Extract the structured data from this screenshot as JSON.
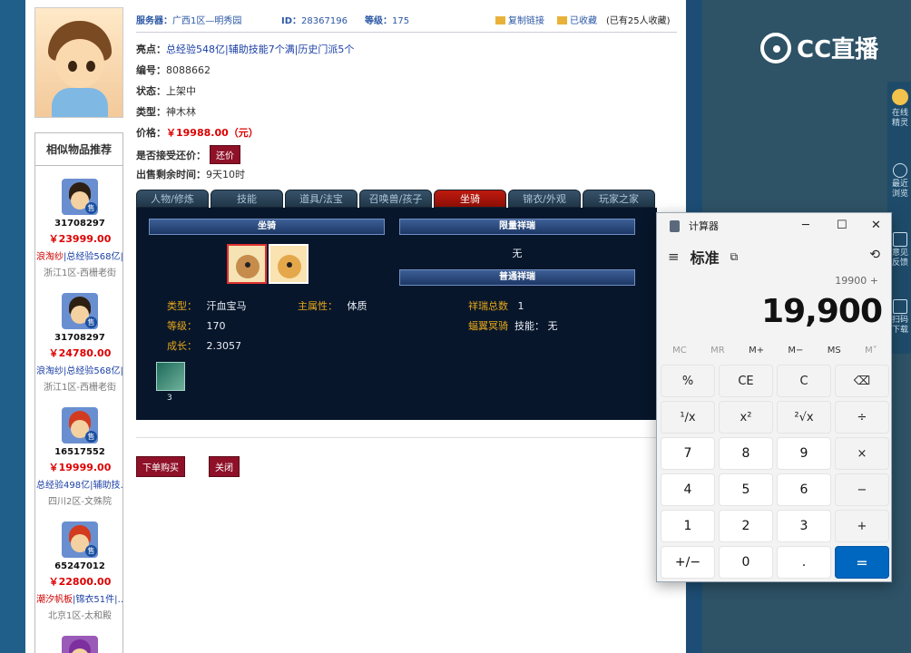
{
  "server": {
    "label": "服务器：",
    "value": "广西1区—明秀园"
  },
  "id": {
    "label": "ID：",
    "value": "28367196"
  },
  "level": {
    "label": "等级：",
    "value": "175"
  },
  "copy_link": "复制链接",
  "collected": "已收藏",
  "collect_count": "(已有25人收藏)",
  "highlights": {
    "label": "亮点：",
    "value": "总经验548亿|辅助技能7个满|历史门派5个"
  },
  "serial": {
    "label": "编号：",
    "value": "8088662"
  },
  "status": {
    "label": "状态：",
    "value": "上架中"
  },
  "type": {
    "label": "类型：",
    "value": "神木林"
  },
  "price": {
    "label": "价格：",
    "value": "￥19988.00（元）"
  },
  "accept_counter": {
    "label": "是否接受还价：",
    "button": "还价"
  },
  "remaining": {
    "label": "出售剩余时间：",
    "value": "9天10时"
  },
  "tabs": [
    "人物/修炼",
    "技能",
    "道具/法宝",
    "召唤兽/孩子",
    "坐骑",
    "锦衣/外观",
    "玩家之家"
  ],
  "panel": {
    "mount_title": "坐骑",
    "limited_title": "限量祥瑞",
    "limited_value": "无",
    "normal_title": "普通祥瑞",
    "attrs": [
      {
        "k": "类型：",
        "v": "汗血宝马"
      },
      {
        "k": "主属性：",
        "v": "体质"
      },
      {
        "k": "等级：",
        "v": "170"
      },
      {
        "k": "成长：",
        "v": "2.3057"
      }
    ],
    "right_attrs": [
      {
        "k": "祥瑞总数",
        "v": "1"
      },
      {
        "k": "蝠翼冥骑",
        "v": "技能：  无"
      }
    ],
    "skill_count": "3"
  },
  "buttons": {
    "buy": "下单购买",
    "close": "关闭"
  },
  "similar": {
    "title": "相似物品推荐",
    "items": [
      {
        "id": "31708297",
        "price": "￥23999.00",
        "desc_red": "浪淘纱",
        "desc": "|总经验568亿|…",
        "server": "浙江1区-西栅老街"
      },
      {
        "id": "31708297",
        "price": "￥24780.00",
        "desc_red": "",
        "desc": "浪淘纱|总经验568亿|…",
        "server": "浙江1区-西栅老街"
      },
      {
        "id": "16517552",
        "price": "￥19999.00",
        "desc_red": "",
        "desc": "总经验498亿|辅助技…",
        "server": "四川2区-文殊院"
      },
      {
        "id": "65247012",
        "price": "￥22800.00",
        "desc_red": "潮汐帆板",
        "desc": "|锦衣51件|…",
        "server": "北京1区-太和殿"
      }
    ],
    "sell_badge": "售"
  },
  "cc": {
    "logo": "CC直播",
    "side": [
      "在线精灵",
      "最近浏览",
      "意见反馈",
      "扫码下载"
    ]
  },
  "calculator": {
    "title": "计算器",
    "mode": "标准",
    "expression": "19900 +",
    "display": "19,900",
    "memory": [
      "MC",
      "MR",
      "M+",
      "M−",
      "MS",
      "M˅"
    ],
    "keys": [
      "%",
      "CE",
      "C",
      "⌫",
      "¹∕x",
      "x²",
      "²√x",
      "÷",
      "7",
      "8",
      "9",
      "×",
      "4",
      "5",
      "6",
      "−",
      "1",
      "2",
      "3",
      "+",
      "+∕−",
      "0",
      ".",
      "="
    ]
  },
  "colors": {
    "accent_red": "#8e1128",
    "price_red": "#dd0000",
    "link_blue": "#1a3fa5",
    "calc_eq": "#0067c0",
    "panel_bg": "#08162b"
  }
}
